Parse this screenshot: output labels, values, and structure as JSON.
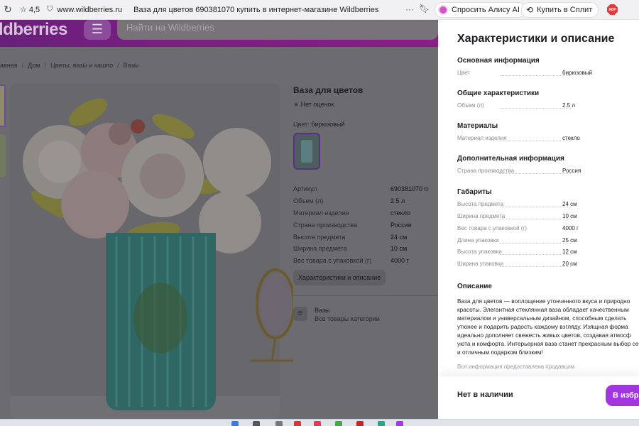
{
  "browser": {
    "reload_icon": "reload-icon",
    "rating": "4,5",
    "url": "www.wildberries.ru",
    "title": "Ваза для цветов 690381070 купить в интернет-магазине Wildberries",
    "alice_label": "Спросить Алису AI",
    "split_label": "Купить в Сплит",
    "abp_label": "ABP"
  },
  "header": {
    "logo": "ldberries",
    "search_placeholder": "Найти на Wildberries"
  },
  "breadcrumb": [
    "авная",
    "Дом",
    "Цветы, вазы и кашпо",
    "Вазы"
  ],
  "product": {
    "title": "Ваза для цветов",
    "rating_text": "Нет оценок",
    "color_label": "Цвет:",
    "color_value": "бирюзовый",
    "specs": [
      {
        "k": "Артикул",
        "v": "690381070"
      },
      {
        "k": "Объем (л)",
        "v": "2.5 л"
      },
      {
        "k": "Материал изделия",
        "v": "стекло"
      },
      {
        "k": "Страна производства",
        "v": "Россия"
      },
      {
        "k": "Высота предмета",
        "v": "24 см"
      },
      {
        "k": "Ширина предмета",
        "v": "10 см"
      },
      {
        "k": "Вес товара с упаковкой (г)",
        "v": "4000 г"
      }
    ],
    "chars_button": "Характеристики и описание",
    "category_title": "Вазы",
    "category_sub": "Все товары категории"
  },
  "panel": {
    "title": "Характеристики и описание",
    "sections": [
      {
        "title": "Основная информация",
        "rows": [
          {
            "k": "Цвет",
            "v": "бирюзовый"
          }
        ]
      },
      {
        "title": "Общие характеристики",
        "rows": [
          {
            "k": "Объем (л)",
            "v": "2.5 л"
          }
        ]
      },
      {
        "title": "Материалы",
        "rows": [
          {
            "k": "Материал изделия",
            "v": "стекло"
          }
        ]
      },
      {
        "title": "Дополнительная информация",
        "rows": [
          {
            "k": "Страна производства",
            "v": "Россия"
          }
        ]
      },
      {
        "title": "Габариты",
        "rows": [
          {
            "k": "Высота предмета",
            "v": "24 см"
          },
          {
            "k": "Ширина предмета",
            "v": "10 см"
          },
          {
            "k": "Вес товара с упаковкой (г)",
            "v": "4000 г"
          },
          {
            "k": "Длина упаковки",
            "v": "25 см"
          },
          {
            "k": "Высота упаковки",
            "v": "12 см"
          },
          {
            "k": "Ширина упаковки",
            "v": "20 см"
          }
        ]
      }
    ],
    "description_title": "Описание",
    "description": "Ваза для цветов — воплощение утонченного вкуса и природно красоты. Элегантная стеклянная ваза обладает качественным материалом и универсальным дизайном, способным сделать утюнее и подарить радость каждому взгляду. Изящная форма идеально дополняет свежесть живых цветов, создавая атмосф уюта и комфорта. Интерьерная ваза станет прекрасным выбор себя и отличным подарком близким!",
    "desc_fade": "Вся информация предоставлена продавцом",
    "out_of_stock": "Нет в наличии",
    "fav_button": "В избра"
  }
}
